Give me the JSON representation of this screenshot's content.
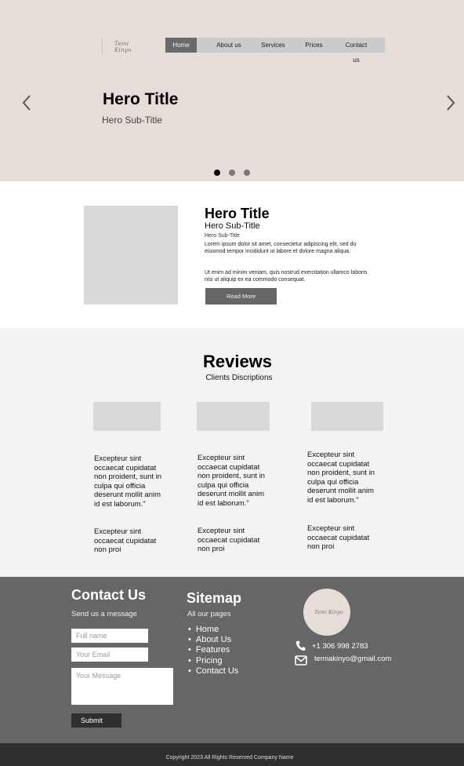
{
  "brand": {
    "logo_text": "Temi Kinyo"
  },
  "nav": {
    "items": [
      {
        "label": "Home",
        "active": true
      },
      {
        "label": "About us"
      },
      {
        "label": "Services"
      },
      {
        "label": "Prices"
      },
      {
        "label": "Contact us"
      }
    ]
  },
  "hero": {
    "title": "Hero Title",
    "subtitle": "Hero Sub-Title",
    "prev_icon": "chevron-left-icon",
    "next_icon": "chevron-right-icon",
    "slides": 3,
    "active_slide": 1
  },
  "about": {
    "title": "Hero Title",
    "subtitle": "Hero Sub-Title",
    "small": "Hero Sub-Title",
    "paragraph1": "Lorem ipsum dolor sit amet, consectetur adipiscing elit, sed do eiusmod tempor incididunt ut labore et dolore magna aliqua.",
    "paragraph2": "Ut enim ad minim veniam, quis nostrud exercitation ullamco laboris nisi ut aliquip ex ea commodo consequat.",
    "button": "Read More"
  },
  "reviews": {
    "title": "Reviews",
    "subtitle": "Clients Discriptions",
    "items": [
      {
        "text1": "Excepteur sint occaecat cupidatat non proident, sunt in culpa qui officia deserunt mollit anim id est laborum.\"",
        "text2": "Excepteur sint occaecat cupidatat non proi"
      },
      {
        "text1": "Excepteur sint occaecat cupidatat non proident, sunt in culpa qui officia deserunt mollit anim id est laborum.\"",
        "text2": "Excepteur sint occaecat cupidatat non proi"
      },
      {
        "text1": "Excepteur sint occaecat cupidatat non proident, sunt in culpa qui officia deserunt mollit anim id est laborum.\"",
        "text2": "Excepteur sint occaecat cupidatat non proi"
      }
    ]
  },
  "contact": {
    "title": "Contact Us",
    "subtitle": "Send us a message",
    "name_placeholder": "Full name",
    "email_placeholder": "Your Email",
    "message_placeholder": "Your Message",
    "submit": "Submit"
  },
  "sitemap": {
    "title": "Sitemap",
    "subtitle": "All our pages",
    "links": [
      "Home",
      "About Us",
      "Features",
      "Pricing",
      "Contact Us"
    ]
  },
  "info": {
    "phone": "+1 306 998 2783",
    "email": "temiakinyo@gmail.com",
    "phone_icon": "phone-icon",
    "mail_icon": "mail-icon"
  },
  "footer": {
    "copyright": "Copyright 2023 All Rights Reserved Company Name"
  },
  "colors": {
    "hero_bg": "#e6dcd8",
    "nav_active": "#6a6a6a",
    "footer_bg": "#666666",
    "copyright_bg": "#2f2f2f"
  }
}
